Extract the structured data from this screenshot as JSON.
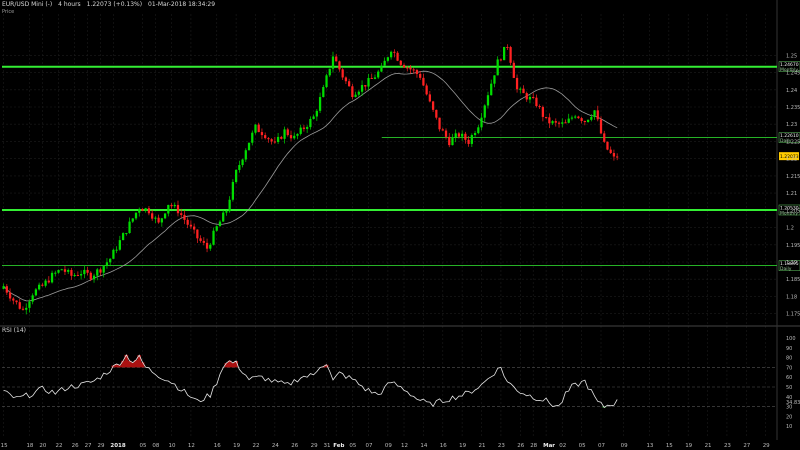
{
  "header": {
    "symbol": "EUR/USD Mini (-)",
    "interval": "4 hours",
    "price_change": "1.22073 (+0.13%)",
    "datetime": "01-Mar-2018 18:34:29",
    "subtitle": "Price"
  },
  "rsi_panel": {
    "title": "RSI (14)"
  },
  "colors": {
    "up": "#00dd00",
    "down": "#ff2222",
    "level_line": "#33ee33",
    "ma": "#9a9a9a",
    "rsi": "#e6e6e6",
    "last_price_badge": "#ffcc00"
  },
  "chart_data": {
    "type": "candlestick",
    "price_axis": {
      "ylim": [
        1.172,
        1.262
      ],
      "ticks": [
        "1.25",
        "1.245",
        "1.24",
        "1.235",
        "1.23",
        "1.225",
        "1.22",
        "1.215",
        "1.21",
        "1.205",
        "1.2",
        "1.195",
        "1.19",
        "1.185",
        "1.18",
        "1.175"
      ]
    },
    "levels": [
      {
        "price": 1.2467,
        "label": "1.24670",
        "tag": "Monthly",
        "weight": "thick"
      },
      {
        "price": 1.2051,
        "label": "1.20530",
        "tag": "Monthly",
        "weight": "thick"
      },
      {
        "price": 1.18895,
        "label": "1.18895",
        "tag": "Daily",
        "weight": "thin"
      },
      {
        "price": 1.2261,
        "label": "1.22610",
        "tag": "Daily",
        "weight": "thin",
        "start_fraction": 0.49
      }
    ],
    "last_price": {
      "price": 1.22073,
      "label": "1.22073"
    },
    "close_path": [
      [
        0,
        1.183
      ],
      [
        3,
        1.179
      ],
      [
        6,
        1.176
      ],
      [
        9,
        1.181
      ],
      [
        12,
        1.183
      ],
      [
        15,
        1.186
      ],
      [
        18,
        1.188
      ],
      [
        21,
        1.186
      ],
      [
        24,
        1.187
      ],
      [
        27,
        1.186
      ],
      [
        30,
        1.188
      ],
      [
        33,
        1.191
      ],
      [
        36,
        1.196
      ],
      [
        39,
        1.201
      ],
      [
        42,
        1.206
      ],
      [
        45,
        1.205
      ],
      [
        48,
        1.201
      ],
      [
        51,
        1.207
      ],
      [
        54,
        1.205
      ],
      [
        57,
        1.201
      ],
      [
        60,
        1.197
      ],
      [
        63,
        1.194
      ],
      [
        66,
        1.2
      ],
      [
        69,
        1.205
      ],
      [
        72,
        1.216
      ],
      [
        75,
        1.223
      ],
      [
        78,
        1.229
      ],
      [
        81,
        1.227
      ],
      [
        84,
        1.224
      ],
      [
        87,
        1.228
      ],
      [
        90,
        1.226
      ],
      [
        93,
        1.229
      ],
      [
        96,
        1.232
      ],
      [
        99,
        1.24
      ],
      [
        102,
        1.25
      ],
      [
        105,
        1.244
      ],
      [
        108,
        1.239
      ],
      [
        111,
        1.241
      ],
      [
        114,
        1.243
      ],
      [
        117,
        1.246
      ],
      [
        120,
        1.252
      ],
      [
        123,
        1.248
      ],
      [
        126,
        1.246
      ],
      [
        129,
        1.244
      ],
      [
        132,
        1.236
      ],
      [
        135,
        1.229
      ],
      [
        138,
        1.225
      ],
      [
        141,
        1.227
      ],
      [
        144,
        1.225
      ],
      [
        147,
        1.23
      ],
      [
        150,
        1.239
      ],
      [
        153,
        1.248
      ],
      [
        156,
        1.253
      ],
      [
        159,
        1.24
      ],
      [
        162,
        1.238
      ],
      [
        165,
        1.236
      ],
      [
        168,
        1.231
      ],
      [
        171,
        1.23
      ],
      [
        174,
        1.23
      ],
      [
        177,
        1.233
      ],
      [
        180,
        1.231
      ],
      [
        183,
        1.234
      ],
      [
        186,
        1.224
      ],
      [
        189,
        1.22
      ],
      [
        190,
        1.2207
      ]
    ],
    "rsi": {
      "ylim": [
        0,
        100
      ],
      "ticks": [
        "100",
        "90",
        "80",
        "70",
        "60",
        "50",
        "40",
        "30",
        "20",
        "10"
      ],
      "guides": [
        70,
        50,
        30
      ],
      "current": "34.8399",
      "path": [
        [
          0,
          45
        ],
        [
          4,
          38
        ],
        [
          8,
          42
        ],
        [
          12,
          48
        ],
        [
          16,
          44
        ],
        [
          20,
          50
        ],
        [
          24,
          52
        ],
        [
          28,
          56
        ],
        [
          32,
          65
        ],
        [
          36,
          75
        ],
        [
          38,
          82
        ],
        [
          40,
          76
        ],
        [
          42,
          80
        ],
        [
          44,
          70
        ],
        [
          48,
          62
        ],
        [
          52,
          55
        ],
        [
          56,
          45
        ],
        [
          60,
          35
        ],
        [
          64,
          42
        ],
        [
          66,
          55
        ],
        [
          68,
          72
        ],
        [
          70,
          76
        ],
        [
          72,
          74
        ],
        [
          74,
          66
        ],
        [
          76,
          58
        ],
        [
          80,
          60
        ],
        [
          84,
          55
        ],
        [
          88,
          52
        ],
        [
          92,
          60
        ],
        [
          96,
          62
        ],
        [
          98,
          72
        ],
        [
          100,
          74
        ],
        [
          102,
          56
        ],
        [
          104,
          64
        ],
        [
          108,
          58
        ],
        [
          112,
          48
        ],
        [
          116,
          42
        ],
        [
          120,
          55
        ],
        [
          124,
          48
        ],
        [
          128,
          38
        ],
        [
          132,
          32
        ],
        [
          136,
          36
        ],
        [
          140,
          40
        ],
        [
          144,
          44
        ],
        [
          148,
          52
        ],
        [
          152,
          65
        ],
        [
          154,
          70
        ],
        [
          156,
          55
        ],
        [
          160,
          45
        ],
        [
          164,
          40
        ],
        [
          168,
          36
        ],
        [
          170,
          32
        ],
        [
          172,
          30
        ],
        [
          174,
          42
        ],
        [
          176,
          50
        ],
        [
          180,
          56
        ],
        [
          182,
          45
        ],
        [
          184,
          34
        ],
        [
          186,
          30
        ],
        [
          190,
          35
        ]
      ]
    },
    "x_axis": {
      "labels": [
        {
          "text": "15",
          "bar": 0
        },
        {
          "text": "18",
          "bar": 8
        },
        {
          "text": "20",
          "bar": 12
        },
        {
          "text": "22",
          "bar": 17
        },
        {
          "text": "26",
          "bar": 22
        },
        {
          "text": "27",
          "bar": 26
        },
        {
          "text": "29",
          "bar": 30
        },
        {
          "text": "2018",
          "bar": 34,
          "bold": true
        },
        {
          "text": "05",
          "bar": 43
        },
        {
          "text": "08",
          "bar": 47
        },
        {
          "text": "10",
          "bar": 52
        },
        {
          "text": "12",
          "bar": 58
        },
        {
          "text": "16",
          "bar": 66
        },
        {
          "text": "19",
          "bar": 72
        },
        {
          "text": "22",
          "bar": 78
        },
        {
          "text": "24",
          "bar": 84
        },
        {
          "text": "26",
          "bar": 90
        },
        {
          "text": "29",
          "bar": 96
        },
        {
          "text": "31",
          "bar": 100
        },
        {
          "text": "Feb",
          "bar": 103,
          "bold": true
        },
        {
          "text": "05",
          "bar": 108
        },
        {
          "text": "07",
          "bar": 113
        },
        {
          "text": "09",
          "bar": 119
        },
        {
          "text": "12",
          "bar": 124
        },
        {
          "text": "14",
          "bar": 130
        },
        {
          "text": "16",
          "bar": 136
        },
        {
          "text": "19",
          "bar": 142
        },
        {
          "text": "21",
          "bar": 148
        },
        {
          "text": "23",
          "bar": 154
        },
        {
          "text": "26",
          "bar": 160
        },
        {
          "text": "28",
          "bar": 164
        },
        {
          "text": "Mar",
          "bar": 168,
          "bold": true
        },
        {
          "text": "02",
          "bar": 173
        },
        {
          "text": "05",
          "bar": 179
        },
        {
          "text": "07",
          "bar": 185
        },
        {
          "text": "09",
          "bar": 192
        },
        {
          "text": "13",
          "bar": 200
        },
        {
          "text": "15",
          "bar": 206
        },
        {
          "text": "19",
          "bar": 212
        },
        {
          "text": "21",
          "bar": 218
        },
        {
          "text": "23",
          "bar": 224
        },
        {
          "text": "27",
          "bar": 230
        },
        {
          "text": "29",
          "bar": 236
        }
      ]
    }
  }
}
